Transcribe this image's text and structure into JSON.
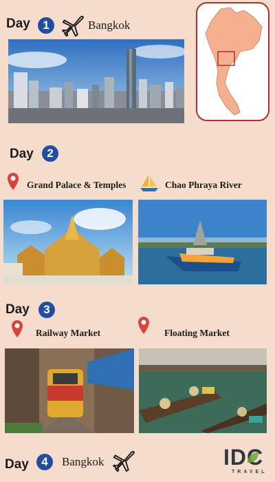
{
  "days": [
    {
      "word": "Day",
      "number": "1",
      "city": "Bangkok"
    },
    {
      "word": "Day",
      "number": "2"
    },
    {
      "word": "Day",
      "number": "3"
    },
    {
      "word": "Day",
      "number": "4",
      "city": "Bangkok"
    }
  ],
  "places": {
    "grand_palace": "Grand Palace & Temples",
    "chao_phraya": "Chao Phraya River",
    "railway_market": "Railway Market",
    "floating_market": "Floating Market"
  },
  "logo": {
    "main": "IDC",
    "sub": "TRAVEL"
  },
  "colors": {
    "background": "#f6dccd",
    "day_badge": "#1f4f9e",
    "pin": "#d9443a",
    "map_land": "#f4b08f",
    "map_border": "#b92c2c",
    "logo_green": "#6aa83a"
  },
  "icons": [
    "airplane-icon",
    "location-pin-icon",
    "sailboat-icon",
    "thailand-map"
  ]
}
